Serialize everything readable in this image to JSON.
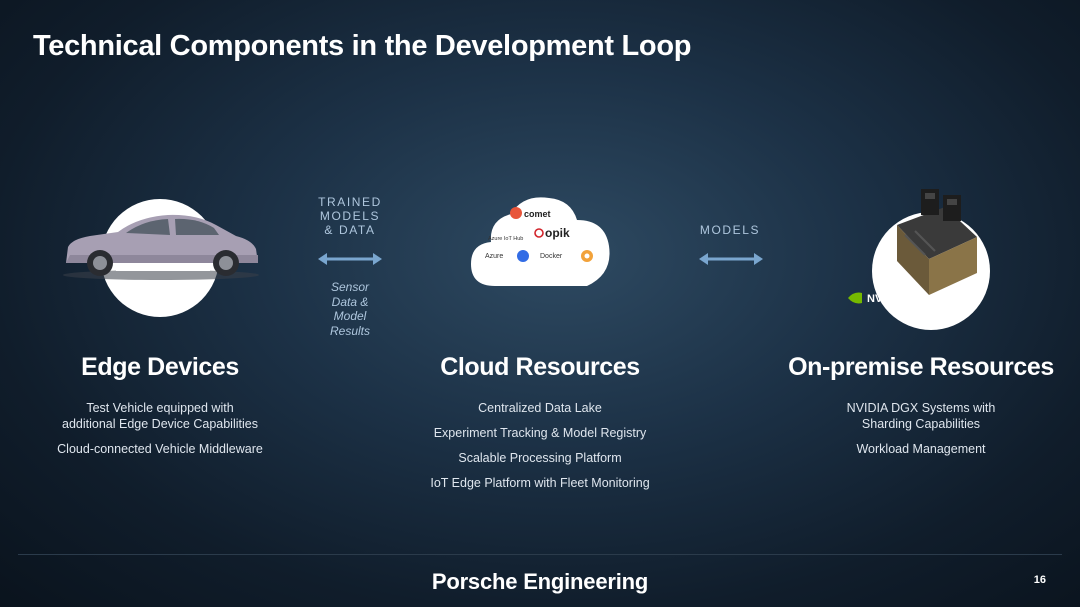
{
  "slide": {
    "title": "Technical Components in the Development Loop",
    "footer": "Porsche Engineering",
    "page_number": "16"
  },
  "colors": {
    "background": "#16283a",
    "arrow": "#7aa6cf",
    "label": "#aec6dd"
  },
  "columns": {
    "edge": {
      "heading": "Edge Devices",
      "items": [
        "Test Vehicle equipped with additional Edge Device Capabilities",
        "Cloud-connected Vehicle Middleware"
      ]
    },
    "cloud": {
      "heading": "Cloud Resources",
      "items": [
        "Centralized Data Lake",
        "Experiment Tracking & Model Registry",
        "Scalable Processing Platform",
        "IoT Edge Platform with Fleet Monitoring"
      ],
      "logos": {
        "comet": "comet",
        "azure_iot_hub": "Azure IoT Hub",
        "opik": "opik",
        "azure": "Azure",
        "docker": "Docker"
      }
    },
    "onprem": {
      "heading": "On-premise Resources",
      "items": [
        "NVIDIA DGX Systems with Sharding Capabilities",
        "Workload Management"
      ],
      "logo": "NVIDIA"
    }
  },
  "arrows": {
    "left": {
      "label_lines": [
        "TRAINED",
        "MODELS",
        "& DATA"
      ],
      "sub_lines": [
        "Sensor",
        "Data &",
        "Model",
        "Results"
      ]
    },
    "right": {
      "label_lines": [
        "MODELS"
      ]
    }
  }
}
